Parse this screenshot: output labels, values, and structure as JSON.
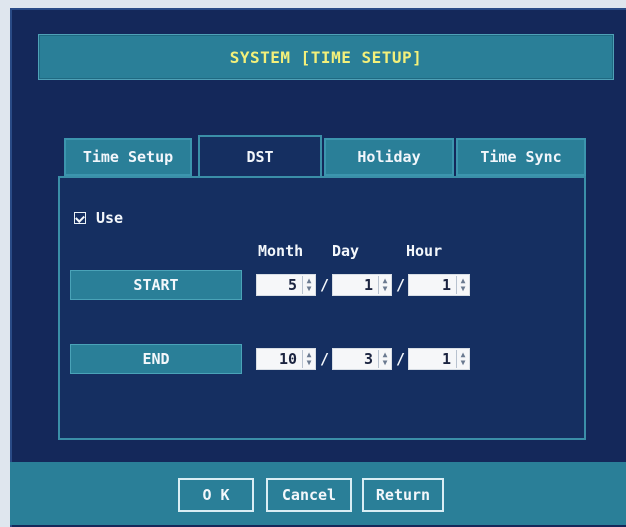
{
  "window": {
    "title": "SYSTEM [TIME SETUP]"
  },
  "tabs": [
    {
      "label": "Time Setup",
      "active": false
    },
    {
      "label": "DST",
      "active": true
    },
    {
      "label": "Holiday",
      "active": false
    },
    {
      "label": "Time Sync",
      "active": false
    }
  ],
  "dst": {
    "use_label": "Use",
    "use_checked": true,
    "headers": {
      "month": "Month",
      "day": "Day",
      "hour": "Hour"
    },
    "start": {
      "label": "START",
      "month": "5",
      "day": "1",
      "hour": "1"
    },
    "end": {
      "label": "END",
      "month": "10",
      "day": "3",
      "hour": "1"
    },
    "separator": "/"
  },
  "buttons": {
    "ok": "O K",
    "cancel": "Cancel",
    "return": "Return"
  },
  "colors": {
    "background": "#14285a",
    "accent": "#2a7f98",
    "title_text": "#f3f07a",
    "text": "#f3f7fb"
  }
}
